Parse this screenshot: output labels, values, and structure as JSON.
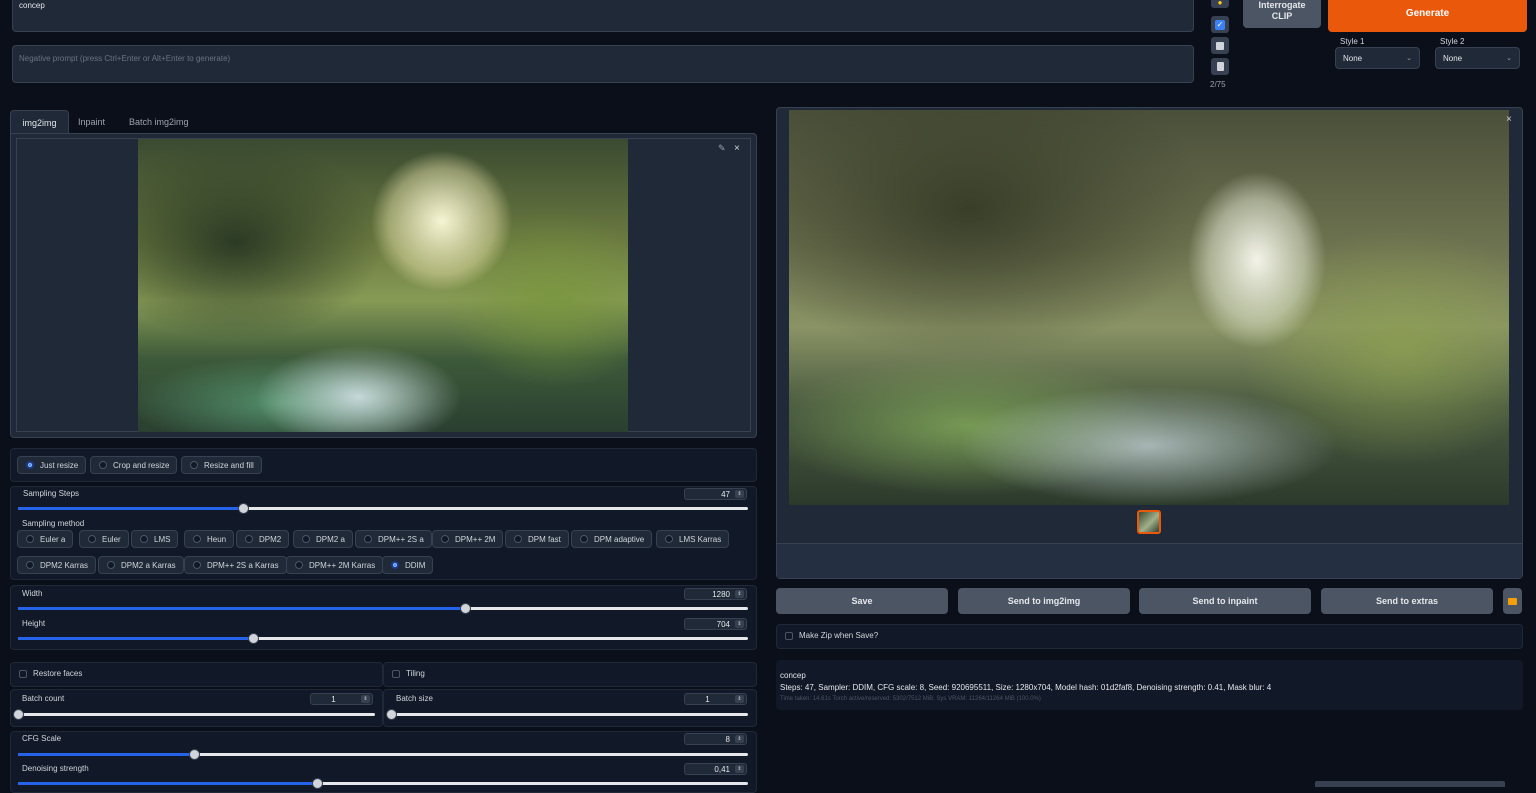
{
  "prompt": {
    "value": "concep"
  },
  "negative_prompt": {
    "placeholder": "Negative prompt (press Ctrl+Enter or Alt+Enter to generate)"
  },
  "token_counter": "2/75",
  "buttons": {
    "interrogate": "Interrogate CLIP",
    "generate": "Generate"
  },
  "styles": [
    {
      "label": "Style 1",
      "value": "None"
    },
    {
      "label": "Style 2",
      "value": "None"
    }
  ],
  "tabs": [
    "img2img",
    "Inpaint",
    "Batch img2img"
  ],
  "resize_modes": {
    "options": [
      "Just resize",
      "Crop and resize",
      "Resize and fill"
    ],
    "selected": "Just resize"
  },
  "sampling_steps": {
    "label": "Sampling Steps",
    "value": 47,
    "min": 1,
    "max": 150
  },
  "sampling_method": {
    "label": "Sampling method",
    "options": [
      "Euler a",
      "Euler",
      "LMS",
      "Heun",
      "DPM2",
      "DPM2 a",
      "DPM++ 2S a",
      "DPM++ 2M",
      "DPM fast",
      "DPM adaptive",
      "LMS Karras",
      "DPM2 Karras",
      "DPM2 a Karras",
      "DPM++ 2S a Karras",
      "DPM++ 2M Karras",
      "DDIM"
    ],
    "selected": "DDIM"
  },
  "width": {
    "label": "Width",
    "value": 1280,
    "min": 64,
    "max": 2048
  },
  "height": {
    "label": "Height",
    "value": 704,
    "min": 64,
    "max": 2048
  },
  "restore_faces": {
    "label": "Restore faces",
    "checked": false
  },
  "tiling": {
    "label": "Tiling",
    "checked": false
  },
  "batch_count": {
    "label": "Batch count",
    "value": 1,
    "min": 1,
    "max": 100
  },
  "batch_size": {
    "label": "Batch size",
    "value": 1,
    "min": 1,
    "max": 8
  },
  "cfg_scale": {
    "label": "CFG Scale",
    "value": 8,
    "min": 1,
    "max": 30
  },
  "denoising_strength": {
    "label": "Denoising strength",
    "value": "0,41",
    "fraction": 0.41
  },
  "output_actions": {
    "save": "Save",
    "send_img2img": "Send to img2img",
    "send_inpaint": "Send to inpaint",
    "send_extras": "Send to extras"
  },
  "make_zip": {
    "label": "Make Zip when Save?",
    "checked": false
  },
  "generation_info": {
    "prompt": "concep",
    "params": "Steps: 47, Sampler: DDIM, CFG scale: 8, Seed: 920695511, Size: 1280x704, Model hash: 01d2faf8, Denoising strength: 0.41, Mask blur: 4",
    "timing": "Time taken: 14.61s  Torch active/reserved: 5302/7512 MiB, Sys VRAM: 11264/11264 MiB (100.0%)"
  },
  "colors": {
    "background": "#0b0f19",
    "accent": "#ea580c",
    "slider_fill": "#2563eb"
  },
  "icons": [
    "paint-icon",
    "check-icon",
    "trash-icon",
    "clipboard-icon",
    "pencil-icon",
    "close-icon",
    "folder-icon"
  ]
}
